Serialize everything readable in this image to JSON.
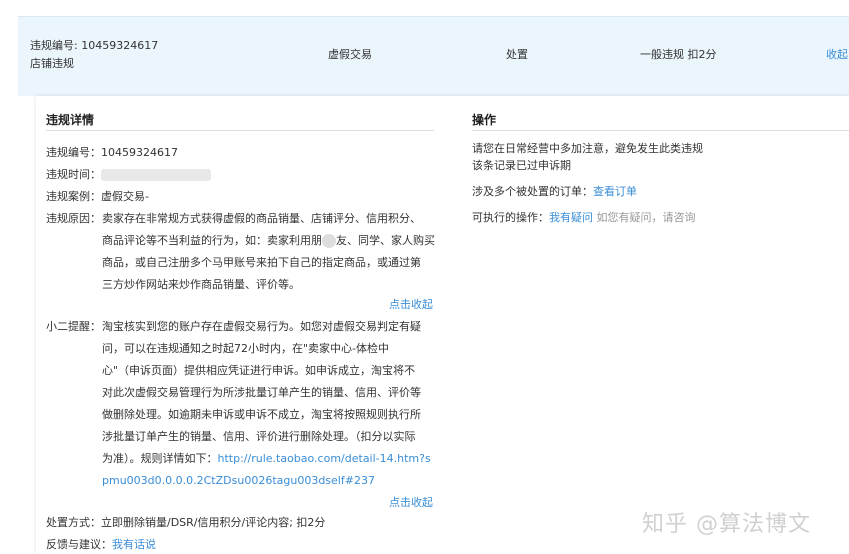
{
  "summary": {
    "violation_id_label": "违规编号:",
    "violation_id": "10459324617",
    "category": "店铺违规",
    "type": "虚假交易",
    "status": "处置",
    "penalty": "一般违规 扣2分",
    "collapse_label": "收起"
  },
  "details": {
    "title": "违规详情",
    "id_label": "违规编号：",
    "id_value": "10459324617",
    "time_label": "违规时间：",
    "case_label": "违规案例：",
    "case_value": "虚假交易-",
    "reason_label": "违规原因：",
    "reason_lines": [
      "卖家存在非常规方式获得虚假的商品销量、店铺评分、信用积分、",
      "商品评论等不当利益的行为，如：卖家利用朋",
      "友、同学、家人购买",
      "商品，或自己注册多个马甲账号来拍下自己的指定商品，或通过第",
      "三方炒作网站来炒作商品销量、评价等。"
    ],
    "fold_label_1": "点击收起",
    "reminder_label": "小二提醒：",
    "reminder_lines": [
      "淘宝核实到您的账户存在虚假交易行为。如您对虚假交易判定有疑",
      "问，可以在违规通知之时起72小时内，在\"卖家中心-体检中",
      "心\"（申诉页面）提供相应凭证进行申诉。如申诉成立，淘宝将不",
      "对此次虚假交易管理行为所涉批量订单产生的销量、信用、评价等",
      "做删除处理。如逾期未申诉或申诉不成立，淘宝将按照规则执行所",
      "涉批量订单产生的销量、信用、评价进行删除处理。（扣分以实际",
      "为准）。规则详情如下："
    ],
    "rule_link_1": "http://rule.taobao.com/detail-14.htm?s",
    "rule_link_2": "pmu003d0.0.0.0.2CtZDsu0026tagu003dself#237",
    "fold_label_2": "点击收起",
    "handling_label": "处置方式：",
    "handling_value": "立即删除销量/DSR/信用积分/评论内容; 扣2分",
    "feedback_label": "反馈与建议：",
    "feedback_link": "我有话说"
  },
  "operations": {
    "title": "操作",
    "notice_line_1": "请您在日常经营中多加注意，避免发生此类违规",
    "notice_line_2": "该条记录已过申诉期",
    "orders_label": "涉及多个被处置的订单：",
    "orders_link": "查看订单",
    "actions_label": "可执行的操作：",
    "actions_link": "我有疑问",
    "actions_hint": "如您有疑问，请咨询"
  },
  "watermark": "知乎 @算法博文",
  "colors": {
    "link": "#3a8dd6",
    "summary_bg": "#eaf5fc"
  }
}
